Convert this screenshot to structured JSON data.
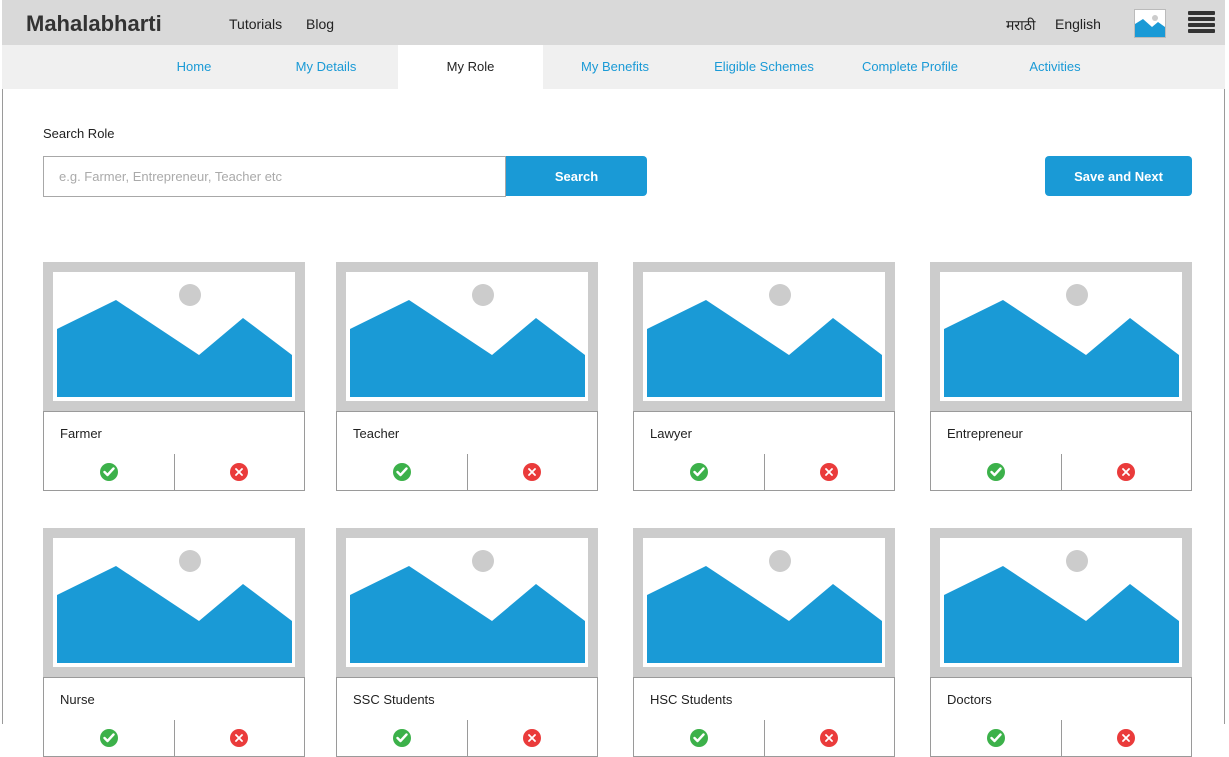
{
  "brand": "Mahalabharti",
  "top_links": [
    "Tutorials",
    "Blog"
  ],
  "languages": [
    "मराठी",
    "English"
  ],
  "tabs": [
    {
      "label": "Home",
      "active": false
    },
    {
      "label": "My Details",
      "active": false
    },
    {
      "label": "My Role",
      "active": true
    },
    {
      "label": "My Benefits",
      "active": false
    },
    {
      "label": "Eligible Schemes",
      "active": false
    },
    {
      "label": "Complete Profile",
      "active": false
    },
    {
      "label": "Activities",
      "active": false
    }
  ],
  "search": {
    "label": "Search Role",
    "placeholder": "e.g. Farmer, Entrepreneur, Teacher etc",
    "button": "Search"
  },
  "save_button": "Save and Next",
  "roles": [
    {
      "name": "Farmer"
    },
    {
      "name": "Teacher"
    },
    {
      "name": "Lawyer"
    },
    {
      "name": "Entrepreneur"
    },
    {
      "name": "Nurse"
    },
    {
      "name": "SSC Students"
    },
    {
      "name": "HSC Students"
    },
    {
      "name": "Doctors"
    }
  ],
  "icons": {
    "accept": "check-circle-icon",
    "reject": "x-circle-icon",
    "image": "image-placeholder-icon",
    "menu": "hamburger-menu-icon"
  },
  "colors": {
    "accent": "#1a9ad6",
    "accept": "#3cb14a",
    "reject": "#ea3b3b",
    "topbar": "#d9d9d9"
  }
}
